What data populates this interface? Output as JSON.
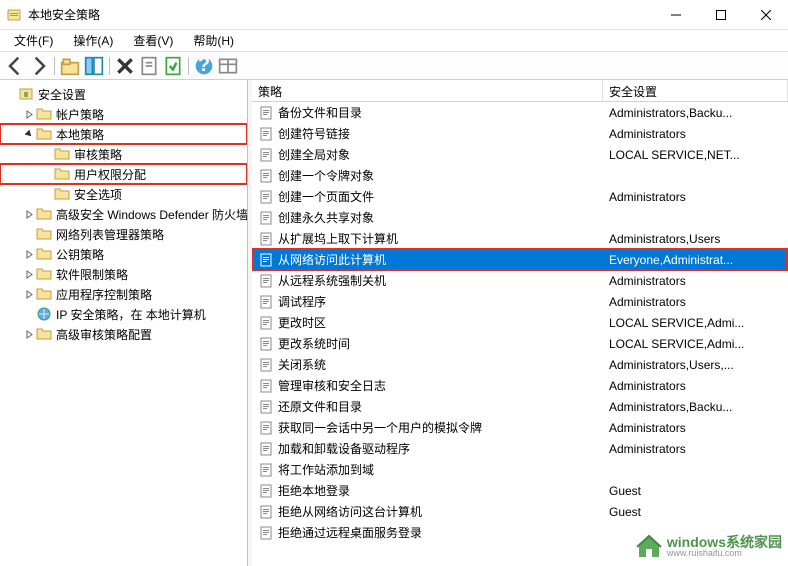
{
  "window": {
    "title": "本地安全策略"
  },
  "menu": {
    "file": "文件(F)",
    "action": "操作(A)",
    "view": "查看(V)",
    "help": "帮助(H)"
  },
  "tree": {
    "root": "安全设置",
    "items": [
      {
        "label": "帐户策略",
        "indent": 1,
        "expand": "closed"
      },
      {
        "label": "本地策略",
        "indent": 1,
        "expand": "open",
        "hl": true
      },
      {
        "label": "审核策略",
        "indent": 2,
        "expand": "none"
      },
      {
        "label": "用户权限分配",
        "indent": 2,
        "expand": "none",
        "hl": true
      },
      {
        "label": "安全选项",
        "indent": 2,
        "expand": "none"
      },
      {
        "label": "高级安全 Windows Defender 防火墙",
        "indent": 1,
        "expand": "closed"
      },
      {
        "label": "网络列表管理器策略",
        "indent": 1,
        "expand": "none"
      },
      {
        "label": "公钥策略",
        "indent": 1,
        "expand": "closed"
      },
      {
        "label": "软件限制策略",
        "indent": 1,
        "expand": "closed"
      },
      {
        "label": "应用程序控制策略",
        "indent": 1,
        "expand": "closed"
      },
      {
        "label": "IP 安全策略，在 本地计算机",
        "indent": 1,
        "expand": "none",
        "icon": "ip"
      },
      {
        "label": "高级审核策略配置",
        "indent": 1,
        "expand": "closed"
      }
    ]
  },
  "list": {
    "col_policy": "策略",
    "col_setting": "安全设置",
    "rows": [
      {
        "policy": "备份文件和目录",
        "setting": "Administrators,Backu..."
      },
      {
        "policy": "创建符号链接",
        "setting": "Administrators"
      },
      {
        "policy": "创建全局对象",
        "setting": "LOCAL SERVICE,NET..."
      },
      {
        "policy": "创建一个令牌对象",
        "setting": ""
      },
      {
        "policy": "创建一个页面文件",
        "setting": "Administrators"
      },
      {
        "policy": "创建永久共享对象",
        "setting": ""
      },
      {
        "policy": "从扩展坞上取下计算机",
        "setting": "Administrators,Users"
      },
      {
        "policy": "从网络访问此计算机",
        "setting": "Everyone,Administrat...",
        "selected": true,
        "hl": true
      },
      {
        "policy": "从远程系统强制关机",
        "setting": "Administrators"
      },
      {
        "policy": "调试程序",
        "setting": "Administrators"
      },
      {
        "policy": "更改时区",
        "setting": "LOCAL SERVICE,Admi..."
      },
      {
        "policy": "更改系统时间",
        "setting": "LOCAL SERVICE,Admi..."
      },
      {
        "policy": "关闭系统",
        "setting": "Administrators,Users,..."
      },
      {
        "policy": "管理审核和安全日志",
        "setting": "Administrators"
      },
      {
        "policy": "还原文件和目录",
        "setting": "Administrators,Backu..."
      },
      {
        "policy": "获取同一会话中另一个用户的模拟令牌",
        "setting": "Administrators"
      },
      {
        "policy": "加载和卸载设备驱动程序",
        "setting": "Administrators"
      },
      {
        "policy": "将工作站添加到域",
        "setting": ""
      },
      {
        "policy": "拒绝本地登录",
        "setting": "Guest"
      },
      {
        "policy": "拒绝从网络访问这台计算机",
        "setting": "Guest"
      },
      {
        "policy": "拒绝通过远程桌面服务登录",
        "setting": ""
      }
    ]
  },
  "watermark": {
    "line1": "windows系统家园",
    "line2": "www.ruishaifu.com"
  }
}
